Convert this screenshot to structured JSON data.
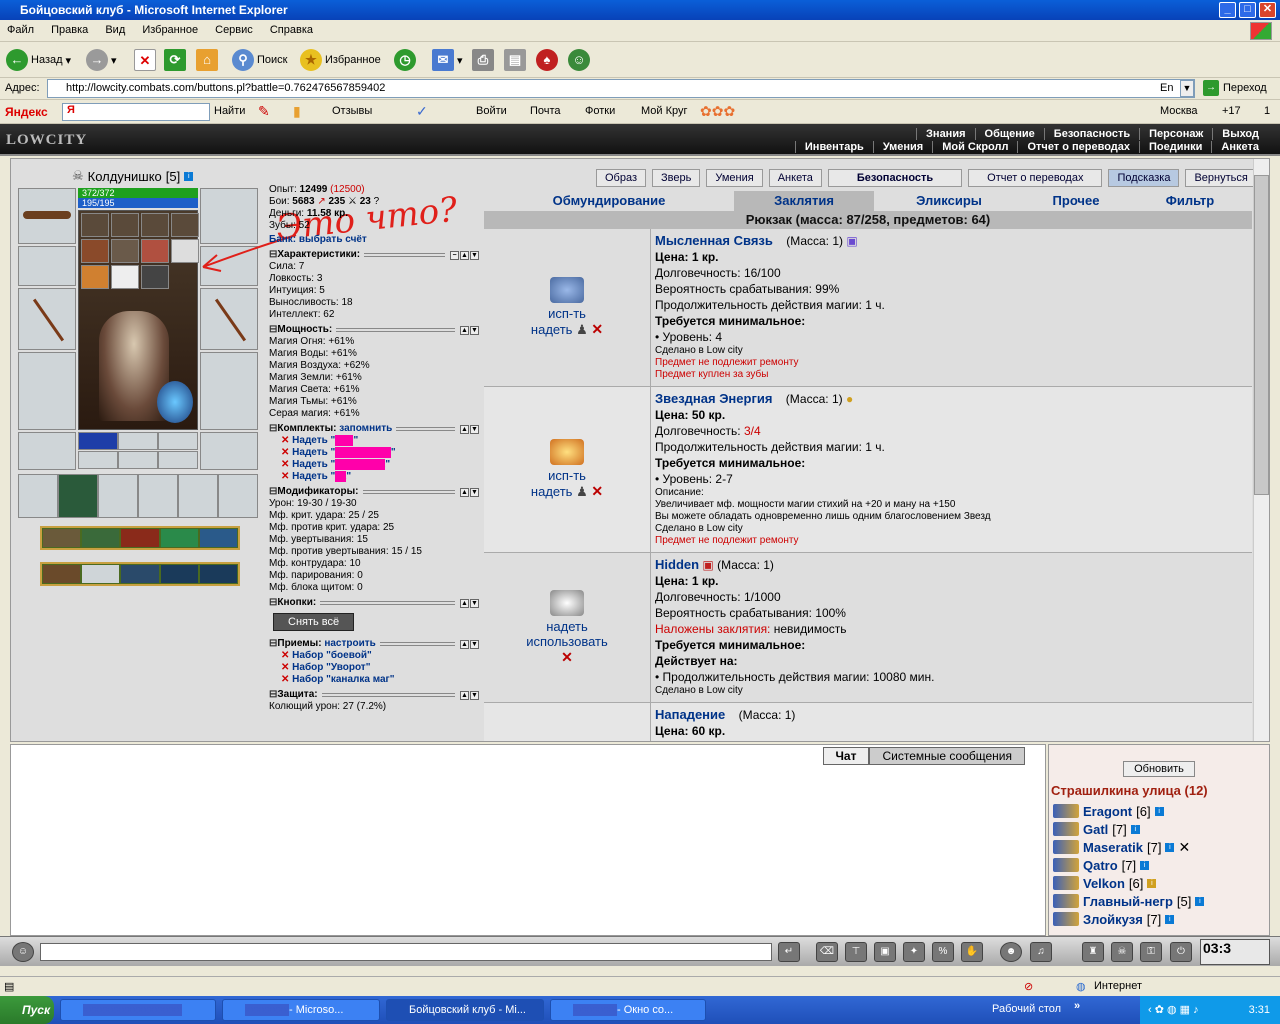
{
  "window": {
    "title": "Бойцовский клуб - Microsoft Internet Explorer",
    "menu": [
      "Файл",
      "Правка",
      "Вид",
      "Избранное",
      "Сервис",
      "Справка"
    ]
  },
  "toolbar": {
    "back": "Назад",
    "search": "Поиск",
    "favorites": "Избранное"
  },
  "address": {
    "label": "Адрес:",
    "url": "http://lowcity.combats.com/buttons.pl?battle=0.762476567859402",
    "lang": "En",
    "go": "Переход"
  },
  "yandex": {
    "brand": "Яндекс",
    "find": "Найти",
    "reviews": "Отзывы",
    "login": "Войти",
    "mail": "Почта",
    "photos": "Фотки",
    "circle": "Мой Круг",
    "city": "Москва",
    "temp": "+17",
    "count": "1"
  },
  "game_nav": {
    "logo": "LOWCITY",
    "row1": [
      "Знания",
      "Общение",
      "Безопасность",
      "Персонаж",
      "Выход"
    ],
    "row2": [
      "Инвентарь",
      "Умения",
      "Мой Скролл",
      "Отчет о переводах",
      "Поединки",
      "Анкета"
    ]
  },
  "character": {
    "name": "Колдунишко",
    "level": "[5]",
    "hp": "372/372",
    "mana": "195/195"
  },
  "annotation": "Это что?",
  "stats": {
    "exp_label": "Опыт:",
    "exp": "12499",
    "exp_next": "(12500)",
    "fights_label": "Бои:",
    "wins": "5683",
    "losses": "235",
    "draws": "23",
    "money_label": "Деньги:",
    "money": "11.58 кр.",
    "teeth_label": "Зубы:",
    "teeth": "52",
    "bank": "Банк: выбрать счёт",
    "sec_chars": "Характеристики:",
    "chars": [
      "Сила: 7",
      "Ловкость: 3",
      "Интуиция: 5",
      "Выносливость: 18",
      "Интеллект: 62"
    ],
    "sec_power": "Мощность:",
    "power": [
      "Магия Огня: +61%",
      "Магия Воды: +61%",
      "Магия Воздуха: +62%",
      "Магия Земли: +61%",
      "Магия Света: +61%",
      "Магия Тьмы: +61%",
      "Серая магия: +61%"
    ],
    "sec_sets": "Комплекты:",
    "remember": "запомнить",
    "sets": [
      "Надеть \"",
      "Надеть \"",
      "Надеть \"",
      "Надеть \""
    ],
    "sec_mods": "Модификаторы:",
    "mods": [
      "Урон: 19-30 / 19-30",
      "Мф. крит. удара: 25 / 25",
      "Мф. против крит. удара: 25",
      "Мф. увертывания: 15",
      "Мф. против увертывания: 15 / 15",
      "Мф. контрудара: 10",
      "Мф. парирования: 0",
      "Мф. блока щитом: 0"
    ],
    "sec_buttons": "Кнопки:",
    "remove_all": "Снять всё",
    "sec_tricks": "Приемы:",
    "tune": "настроить",
    "tricks": [
      "Набор \"боевой\"",
      "Набор \"Уворот\"",
      "Набор \"каналка маг\""
    ],
    "sec_def": "Защита:",
    "defense": "Колющий урон: 27 (7.2%)"
  },
  "top_buttons": [
    "Образ",
    "Зверь",
    "Умения",
    "Анкета",
    "Безопасность",
    "Отчет о переводах",
    "Подсказка",
    "Вернуться"
  ],
  "tabs": [
    "Обмундирование",
    "Заклятия",
    "Эликсиры",
    "Прочее",
    "Фильтр"
  ],
  "bag_title": "Рюкзак (масса: 87/258, предметов: 64)",
  "items": [
    {
      "act1": "исп-ть",
      "act2": "надеть",
      "name": "Мысленная Связь",
      "mass": "(Масса: 1)",
      "price": "Цена: 1 кр.",
      "dur": "Долговечность: 16/100",
      "l1": "Вероятность срабатывания: 99%",
      "l2": "Продолжительность действия магии: 1 ч.",
      "req": "Требуется минимальное:",
      "lvl": "• Уровень: 4",
      "made": "Сделано в Low city",
      "r1": "Предмет не подлежит ремонту",
      "r2": "Предмет куплен за зубы"
    },
    {
      "act1": "исп-ть",
      "act2": "надеть",
      "name": "Звездная Энергия",
      "mass": "(Масса: 1)",
      "price": "Цена: 50 кр.",
      "dur_label": "Долговечность: ",
      "dur_val": "3/4",
      "l2": "Продолжительность действия магии: 1 ч.",
      "req": "Требуется минимальное:",
      "lvl": "• Уровень: 2-7",
      "desc": "Описание:",
      "d1": "Увеличивает мф. мощности магии стихий на +20 и ману на +150",
      "d2": "Вы можете обладать одновременно лишь одним благословением Звезд",
      "made": "Сделано в Low city",
      "r1": "Предмет не подлежит ремонту"
    },
    {
      "act1": "надеть",
      "act2": "использовать",
      "name": "Hidden",
      "mass": "(Масса: 1)",
      "price": "Цена: 1 кр.",
      "dur": "Долговечность: 1/1000",
      "l1": "Вероятность срабатывания: 100%",
      "spell_label": "Наложены заклятия:",
      "spell": "невидимость",
      "req": "Требуется минимальное:",
      "acts_on": "Действует на:",
      "dur2": "• Продолжительность действия магии: 10080 мин.",
      "made": "Сделано в Low city"
    },
    {
      "name": "Нападение",
      "mass": "(Масса: 1)",
      "price": "Цена: 60 кр."
    }
  ],
  "chat": {
    "tab_chat": "Чат",
    "tab_sys": "Системные сообщения"
  },
  "online": {
    "refresh": "Обновить",
    "room": "Страшилкина улица (12)",
    "users": [
      {
        "name": "Eragont",
        "lvl": "[6]"
      },
      {
        "name": "Gatl",
        "lvl": "[7]"
      },
      {
        "name": "Maseratik",
        "lvl": "[7]"
      },
      {
        "name": "Qatro",
        "lvl": "[7]"
      },
      {
        "name": "Velkon",
        "lvl": "[6]"
      },
      {
        "name": "Главный-негр",
        "lvl": "[5]"
      },
      {
        "name": "Злойкузя",
        "lvl": "[7]"
      }
    ]
  },
  "clock": "03:3",
  "statusbar": {
    "zone": "Интернет"
  },
  "taskbar": {
    "start": "Пуск",
    "t2": "- Microso...",
    "t3": "Бойцовский клуб - Mi...",
    "t4": "- Окно co...",
    "desktop": "Рабочий стол",
    "time": "3:31"
  },
  "colors": {
    "accent": "#003388",
    "red": "#cc0000",
    "xp_bar": "#1ea01e",
    "mana_bar": "#1e5fc8"
  }
}
